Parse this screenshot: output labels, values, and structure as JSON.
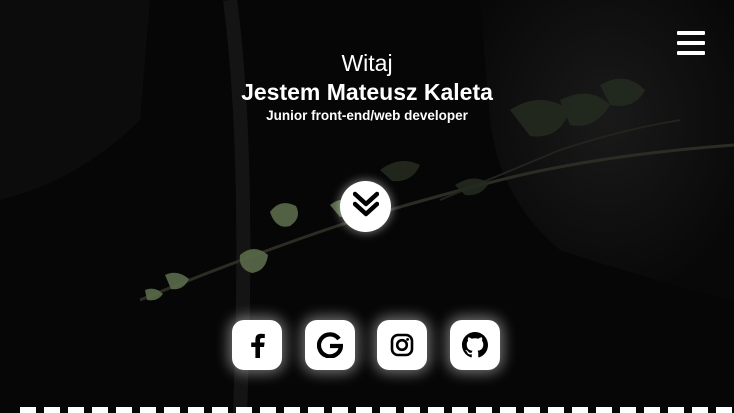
{
  "hero": {
    "greeting": "Witaj",
    "name": "Jestem Mateusz Kaleta",
    "role": "Junior front-end/web developer"
  },
  "icons": {
    "menu": "hamburger-menu-icon",
    "scroll": "double-chevron-down-icon",
    "social": [
      "facebook-icon",
      "google-icon",
      "instagram-icon",
      "github-icon"
    ]
  },
  "colors": {
    "background": "#050505",
    "text": "#ffffff",
    "button": "#ffffff",
    "icon": "#000000"
  }
}
